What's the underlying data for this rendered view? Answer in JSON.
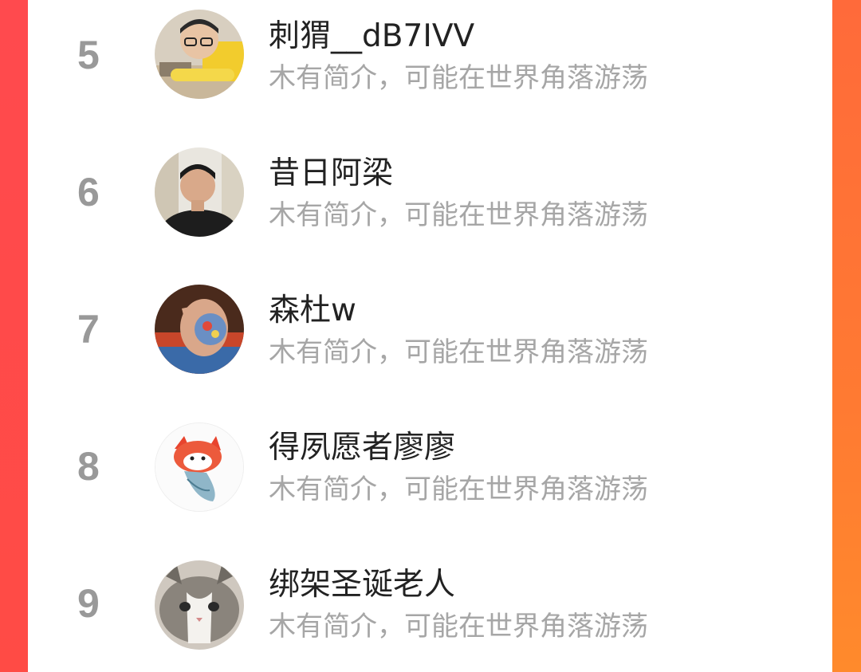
{
  "ranking": {
    "items": [
      {
        "rank": "5",
        "name": "刺猬__dB7IVV",
        "bio": "木有简介，可能在世界角落游荡"
      },
      {
        "rank": "6",
        "name": "昔日阿梁",
        "bio": "木有简介，可能在世界角落游荡"
      },
      {
        "rank": "7",
        "name": "森杜w",
        "bio": "木有简介，可能在世界角落游荡"
      },
      {
        "rank": "8",
        "name": "得夙愿者廖廖",
        "bio": "木有简介，可能在世界角落游荡"
      },
      {
        "rank": "9",
        "name": "绑架圣诞老人",
        "bio": "木有简介，可能在世界角落游荡"
      }
    ]
  },
  "colors": {
    "background_left": "#ff4a45",
    "background_right": "#ff8a2e",
    "card": "#ffffff",
    "rank": "#999999",
    "name": "#222222",
    "bio": "#a6a6a6"
  }
}
